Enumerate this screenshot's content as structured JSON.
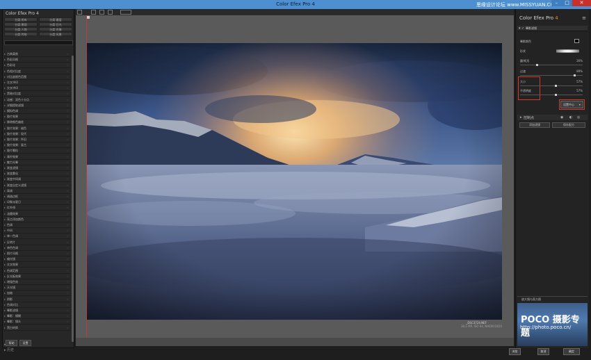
{
  "window": {
    "title": "Color Efex Pro 4",
    "watermark": "思缘设计论坛 www.MISSYUAN.COM",
    "min_label": "–",
    "max_label": "□",
    "close_label": "✕"
  },
  "left_panel": {
    "title": "Color Efex Pro 4",
    "categories": [
      "分类:所有",
      "分类:最爱",
      "分类:景观",
      "分类:日光",
      "分类:人物",
      "分类:肖像",
      "分类:传统",
      "分类:风景"
    ],
    "filters": [
      "古典柔焦",
      "色彩风格",
      "色彩化",
      "色相对比度",
      "对比度颜色范围",
      "交叉冲印",
      "交叉冲印",
      "黑暗对比度",
      "动感：双色十分点",
      "详细提取滤镜",
      "模拟色调",
      "胶片效果",
      "移除颜色偏差",
      "胶片效果：褪色",
      "胶片效果：现代",
      "胶片效果：怀旧",
      "胶片效果：复古",
      "胶片颗粒",
      "青柠效果",
      "魅力光晕",
      "渐变滤镜",
      "渐变雾化",
      "渐变中间调",
      "渐变自定义滤镜",
      "高调",
      "调谐边框",
      "印象派夏日",
      "红外线",
      "油墨效果",
      "亮点添加颜色",
      "色调",
      "中间",
      "单一色调",
      "反转片",
      "单色色调",
      "照片风格",
      "偏光镜",
      "交叉效果",
      "色调范围",
      "反光板效果",
      "增强色效",
      "天光镜",
      "加暗",
      "阴影",
      "色调对比",
      "晕影滤镜",
      "晕影：模糊",
      "晕影：镜头",
      "黑白转换"
    ],
    "presets_label": "配方",
    "history_label": "历史",
    "help_button": "帮助",
    "settings_button": "设置"
  },
  "canvas": {
    "caption_file": "_DSC3724.NEF",
    "caption_meta": "38.2 MP, ISO 64, NIKON D810"
  },
  "right_panel": {
    "title_main": "Color Efex Pro",
    "title_version": "4",
    "filter_name": "晕影滤镜",
    "params": {
      "color_label": "晕影颜色",
      "shape_label": "形状",
      "circle_label": "圆/矩形",
      "circle_value": "26%",
      "transition_label": "过渡",
      "transition_value": "89%",
      "size_label": "大小",
      "size_value": "57%",
      "opacity_label": "不透明度",
      "opacity_value": "57%"
    },
    "center_button": "设置中心",
    "control_points_label": "控制点",
    "add_filter_button": "添加滤镜",
    "save_recipe_button": "保存配方",
    "loupe_label": "放大镜与直方图",
    "brand": "POCO 摄影专题",
    "brand_url": "http://photo.poco.cn/"
  },
  "footer": {
    "browse_button": "浏览",
    "cancel_button": "取消",
    "ok_button": "确定"
  },
  "sliders": {
    "circle": 0.26,
    "transition": 0.89,
    "size": 0.57,
    "opacity": 0.57
  }
}
